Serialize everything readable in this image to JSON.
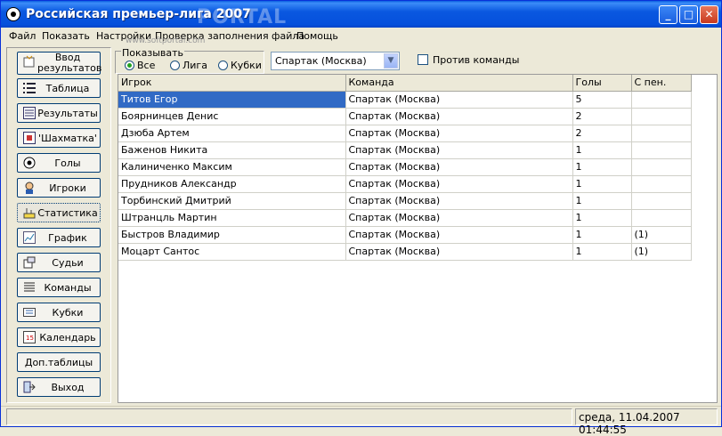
{
  "window": {
    "title": "Российская премьер-лига 2007",
    "watermark": "PORTAL",
    "minimize": "_",
    "maximize": "□",
    "close": "✕"
  },
  "menu": [
    "Файл",
    "Показать",
    "Настройки",
    "Проверка заполнения файла",
    "Помощь"
  ],
  "site_watermark": "www.softportal.com",
  "sidebar": {
    "items": [
      {
        "label": "Ввод результатов",
        "icon": "input-icon"
      },
      {
        "label": "Таблица",
        "icon": "table-icon"
      },
      {
        "label": "Результаты",
        "icon": "results-icon"
      },
      {
        "label": "'Шахматка'",
        "icon": "chessboard-icon"
      },
      {
        "label": "Голы",
        "icon": "ball-icon"
      },
      {
        "label": "Игроки",
        "icon": "players-icon"
      },
      {
        "label": "Статистика",
        "icon": "stats-icon"
      },
      {
        "label": "График",
        "icon": "chart-icon"
      },
      {
        "label": "Судьи",
        "icon": "referee-icon"
      },
      {
        "label": "Команды",
        "icon": "teams-icon"
      },
      {
        "label": "Кубки",
        "icon": "cups-icon"
      },
      {
        "label": "Календарь",
        "icon": "calendar-icon"
      },
      {
        "label": "Доп.таблицы",
        "icon": ""
      },
      {
        "label": "Выход",
        "icon": "exit-icon"
      }
    ]
  },
  "filter": {
    "caption": "Показывать",
    "options": [
      "Все",
      "Лига",
      "Кубки"
    ],
    "selected": "Все"
  },
  "team_select": {
    "value": "Спартак (Москва)"
  },
  "against_team": {
    "label": "Против команды",
    "checked": false
  },
  "table": {
    "columns": [
      "Игрок",
      "Команда",
      "Голы",
      "С пен."
    ],
    "rows": [
      [
        "Титов Егор",
        "Спартак (Москва)",
        "5",
        ""
      ],
      [
        "Боярнинцев Денис",
        "Спартак (Москва)",
        "2",
        ""
      ],
      [
        "Дзюба Артем",
        "Спартак (Москва)",
        "2",
        ""
      ],
      [
        "Баженов Никита",
        "Спартак (Москва)",
        "1",
        ""
      ],
      [
        "Калиниченко Максим",
        "Спартак (Москва)",
        "1",
        ""
      ],
      [
        "Прудников Александр",
        "Спартак (Москва)",
        "1",
        ""
      ],
      [
        "Торбинский Дмитрий",
        "Спартак (Москва)",
        "1",
        ""
      ],
      [
        "Штранцль Мартин",
        "Спартак (Москва)",
        "1",
        ""
      ],
      [
        "Быстров Владимир",
        "Спартак (Москва)",
        "1",
        "(1)"
      ],
      [
        "Моцарт Сантос",
        "Спартак (Москва)",
        "1",
        "(1)"
      ]
    ]
  },
  "status": {
    "datetime": "среда, 11.04.2007 01:44:55"
  }
}
